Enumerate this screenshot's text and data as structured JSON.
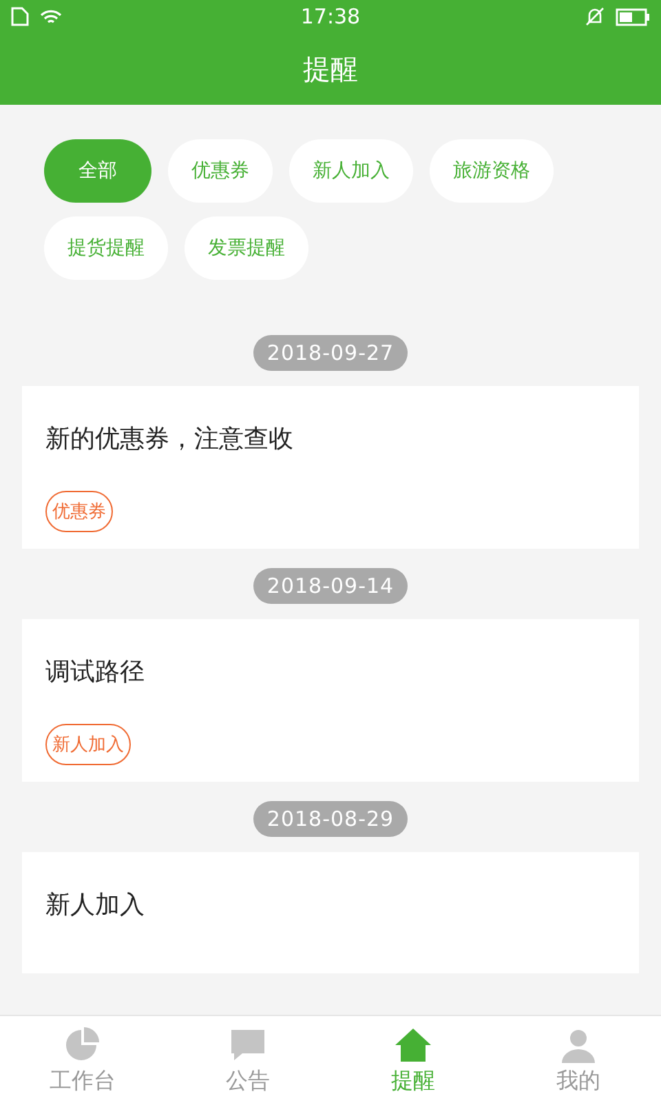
{
  "status_bar": {
    "time": "17:38"
  },
  "header": {
    "title": "提醒"
  },
  "filters": [
    {
      "label": "全部",
      "selected": true
    },
    {
      "label": "优惠券",
      "selected": false
    },
    {
      "label": "新人加入",
      "selected": false
    },
    {
      "label": "旅游资格",
      "selected": false
    },
    {
      "label": "提货提醒",
      "selected": false
    },
    {
      "label": "发票提醒",
      "selected": false
    }
  ],
  "reminders": [
    {
      "date": "2018-09-27",
      "title": "新的优惠券，注意查收",
      "tag": "优惠券"
    },
    {
      "date": "2018-09-14",
      "title": "调试路径",
      "tag": "新人加入"
    },
    {
      "date": "2018-08-29",
      "title": "新人加入"
    }
  ],
  "bottom_nav": [
    {
      "label": "工作台",
      "selected": false
    },
    {
      "label": "公告",
      "selected": false
    },
    {
      "label": "提醒",
      "selected": true
    },
    {
      "label": "我的",
      "selected": false
    }
  ]
}
